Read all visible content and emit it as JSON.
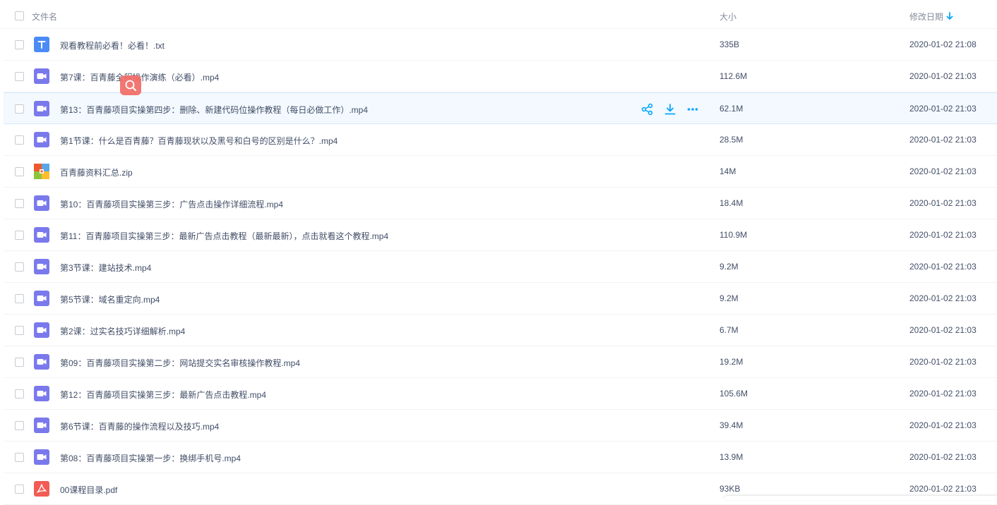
{
  "header": {
    "name_label": "文件名",
    "size_label": "大小",
    "date_label": "修改日期",
    "sort_icon": "arrow-down-icon"
  },
  "colors": {
    "accent": "#06a7ff",
    "video": "#7a79ec",
    "txt": "#4b8bf5",
    "pdf": "#f25c54",
    "hover_row": "#f3f9fe"
  },
  "files": [
    {
      "name": "观看教程前必看！必看！.txt",
      "size": "335B",
      "date": "2020-01-02 21:08",
      "type": "txt"
    },
    {
      "name": "第7课：百青藤全程操作演练（必看）.mp4",
      "size": "112.6M",
      "date": "2020-01-02 21:03",
      "type": "video"
    },
    {
      "name": "第13：百青藤项目实操第四步：删除、新建代码位操作教程（每日必做工作）.mp4",
      "size": "62.1M",
      "date": "2020-01-02 21:03",
      "type": "video",
      "hover": true
    },
    {
      "name": "第1节课：什么是百青藤？百青藤现状以及黑号和白号的区别是什么？.mp4",
      "size": "28.5M",
      "date": "2020-01-02 21:03",
      "type": "video"
    },
    {
      "name": "百青藤资料汇总.zip",
      "size": "14M",
      "date": "2020-01-02 21:03",
      "type": "zip"
    },
    {
      "name": "第10：百青藤项目实操第三步：广告点击操作详细流程.mp4",
      "size": "18.4M",
      "date": "2020-01-02 21:03",
      "type": "video"
    },
    {
      "name": "第11：百青藤项目实操第三步：最新广告点击教程（最新最新），点击就看这个教程.mp4",
      "size": "110.9M",
      "date": "2020-01-02 21:03",
      "type": "video"
    },
    {
      "name": "第3节课：建站技术.mp4",
      "size": "9.2M",
      "date": "2020-01-02 21:03",
      "type": "video"
    },
    {
      "name": "第5节课：域名重定向.mp4",
      "size": "9.2M",
      "date": "2020-01-02 21:03",
      "type": "video"
    },
    {
      "name": "第2课：过实名技巧详细解析.mp4",
      "size": "6.7M",
      "date": "2020-01-02 21:03",
      "type": "video"
    },
    {
      "name": "第09：百青藤项目实操第二步：网站提交实名审核操作教程.mp4",
      "size": "19.2M",
      "date": "2020-01-02 21:03",
      "type": "video"
    },
    {
      "name": "第12：百青藤项目实操第三步：最新广告点击教程.mp4",
      "size": "105.6M",
      "date": "2020-01-02 21:03",
      "type": "video"
    },
    {
      "name": "第6节课：百青藤的操作流程以及技巧.mp4",
      "size": "39.4M",
      "date": "2020-01-02 21:03",
      "type": "video"
    },
    {
      "name": "第08：百青藤项目实操第一步：换绑手机号.mp4",
      "size": "13.9M",
      "date": "2020-01-02 21:03",
      "type": "video"
    },
    {
      "name": "00课程目录.pdf",
      "size": "93KB",
      "date": "2020-01-02 21:03",
      "type": "pdf"
    }
  ],
  "row_actions": [
    "share-icon",
    "download-icon",
    "more-icon"
  ]
}
